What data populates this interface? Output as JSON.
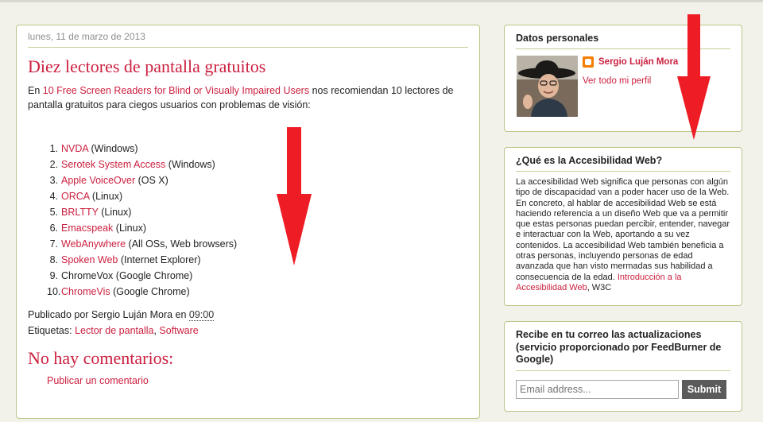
{
  "post": {
    "date": "lunes, 11 de marzo de 2013",
    "title": "Diez lectores de pantalla gratuitos",
    "intro_prefix": "En ",
    "intro_link": "10 Free Screen Readers for Blind or Visually Impaired Users",
    "intro_suffix": " nos recomiendan 10 lectores de pantalla gratuitos para ciegos usuarios con problemas de visión:",
    "items": [
      {
        "num": "1.",
        "name": "NVDA",
        "note": " (Windows)"
      },
      {
        "num": "2.",
        "name": "Serotek System Access",
        "note": " (Windows)"
      },
      {
        "num": "3.",
        "name": "Apple VoiceOver",
        "note": " (OS X)"
      },
      {
        "num": "4.",
        "name": "ORCA",
        "note": " (Linux)"
      },
      {
        "num": "5.",
        "name": "BRLTTY",
        "note": " (Linux)"
      },
      {
        "num": "6.",
        "name": "Emacspeak",
        "note": " (Linux)"
      },
      {
        "num": "7.",
        "name": "WebAnywhere",
        "note": " (All OSs, Web browsers)"
      },
      {
        "num": "8.",
        "name": "Spoken Web",
        "note": " (Internet Explorer)"
      },
      {
        "num": "9.",
        "name": "ChromeVox",
        "note": " (Google Chrome)",
        "plain": true
      },
      {
        "num": "10.",
        "name": "ChromeVis",
        "note": " (Google Chrome)"
      }
    ],
    "published_by": "Publicado por Sergio Luján Mora en ",
    "time": "09:00",
    "labels_prefix": "Etiquetas: ",
    "label1": "Lector de pantalla",
    "label_sep": ", ",
    "label2": "Software",
    "comments_title": "No hay comentarios:",
    "publish_comment": "Publicar un comentario"
  },
  "sidebar": {
    "profile": {
      "title": "Datos personales",
      "name": "Sergio Luján Mora",
      "view_profile": "Ver todo mi perfil"
    },
    "about": {
      "title": "¿Qué es la Accesibilidad Web?",
      "text": "La accesibilidad Web significa que personas con algún tipo de discapacidad van a poder hacer uso de la Web. En concreto, al hablar de accesibilidad Web se está haciendo referencia a un diseño Web que va a permitir que estas personas puedan percibir, entender, navegar e interactuar con la Web, aportando a su vez contenidos. La accesibilidad Web también beneficia a otras personas, incluyendo personas de edad avanzada que han visto mermadas sus habilidad a consecuencia de la edad.",
      "link": "Introducción a la Accesibilidad Web",
      "suffix": ", W3C"
    },
    "subscribe": {
      "title": "Recibe en tu correo las actualizaciones (servicio proporcionado por FeedBurner de Google)",
      "placeholder": "Email address...",
      "submit": "Submit"
    }
  },
  "colors": {
    "link": "#cc1f3e",
    "border": "#bcc486",
    "arrow": "#ee1c25"
  }
}
